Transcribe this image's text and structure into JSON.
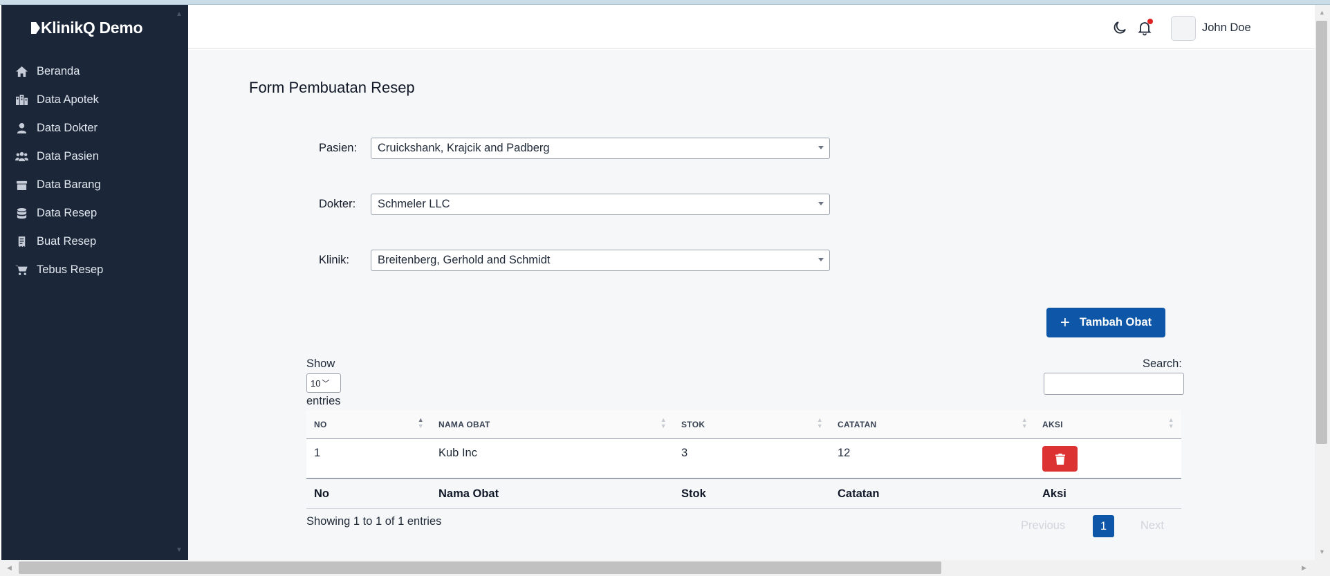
{
  "app": {
    "brand": "KlinikQ Demo"
  },
  "sidebar": {
    "items": [
      {
        "label": "Beranda",
        "icon": "home-icon"
      },
      {
        "label": "Data Apotek",
        "icon": "building-icon"
      },
      {
        "label": "Data Dokter",
        "icon": "doctor-icon"
      },
      {
        "label": "Data Pasien",
        "icon": "users-icon"
      },
      {
        "label": "Data Barang",
        "icon": "box-icon"
      },
      {
        "label": "Data Resep",
        "icon": "database-icon"
      },
      {
        "label": "Buat Resep",
        "icon": "receipt-icon"
      },
      {
        "label": "Tebus Resep",
        "icon": "cart-icon"
      }
    ]
  },
  "header": {
    "user_name": "John Doe",
    "notification_dot_color": "#e02424"
  },
  "page": {
    "title": "Form Pembuatan Resep"
  },
  "form": {
    "pasien": {
      "label": "Pasien:",
      "value": "Cruickshank, Krajcik and Padberg"
    },
    "dokter": {
      "label": "Dokter:",
      "value": "Schmeler LLC"
    },
    "klinik": {
      "label": "Klinik:",
      "value": "Breitenberg, Gerhold and Schmidt"
    }
  },
  "actions": {
    "add_label": "Tambah Obat",
    "accent": "#0d56a8",
    "danger": "#dc3232"
  },
  "datatable": {
    "show_label": "Show",
    "length_value": "10",
    "entries_label": "entries",
    "search_label": "Search:",
    "columns": [
      "NO",
      "NAMA OBAT",
      "STOK",
      "CATATAN",
      "AKSI"
    ],
    "rows": [
      {
        "no": "1",
        "nama_obat": "Kub Inc",
        "stok": "3",
        "catatan": "12"
      }
    ],
    "footer": [
      "No",
      "Nama Obat",
      "Stok",
      "Catatan",
      "Aksi"
    ],
    "info": "Showing 1 to 1 of 1 entries",
    "pagination": {
      "previous": "Previous",
      "current": "1",
      "next": "Next"
    }
  }
}
